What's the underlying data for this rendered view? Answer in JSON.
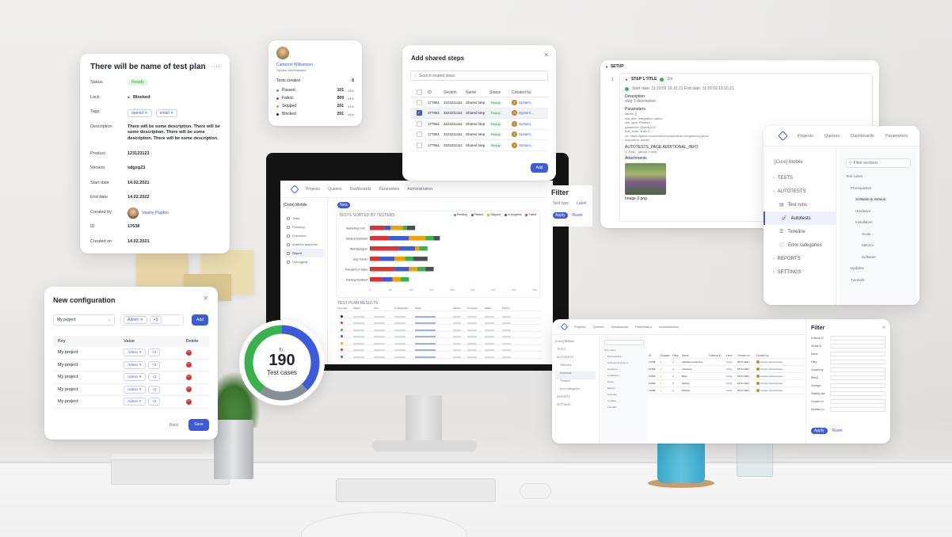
{
  "test_plan": {
    "title": "There will be name of test plan",
    "menu_icon": "more-icon",
    "fields": [
      {
        "label": "Status",
        "value": "Ready"
      },
      {
        "label": "Lock",
        "value": "Blocked"
      },
      {
        "label": "Tags",
        "value": ""
      },
      {
        "label": "Description",
        "value": "There will be some description. There will be some description. There will be some description. There will be some description."
      },
      {
        "label": "Product",
        "value": "123123123"
      },
      {
        "label": "Version",
        "value": "sdgsg23"
      },
      {
        "label": "Start date",
        "value": "14.02.2021"
      },
      {
        "label": "End date",
        "value": "14.02.2022"
      },
      {
        "label": "Created by",
        "value": "Vasiliy Pupkin"
      },
      {
        "label": "ID",
        "value": "17638"
      },
      {
        "label": "Created on",
        "value": "14.02.2021"
      }
    ],
    "tags": [
      "openid",
      "email"
    ]
  },
  "user_stats": {
    "name": "Cameron Williamson",
    "role": "System Administrator",
    "tests_created_label": "Tests created",
    "tests_created_value": "6",
    "rows": [
      {
        "label": "Passed",
        "count": "101",
        "pct": "44%",
        "color": "#37b24d"
      },
      {
        "label": "Failed",
        "count": "909",
        "pct": "34%",
        "color": "#e03131"
      },
      {
        "label": "Skipped",
        "count": "201",
        "pct": "44%",
        "color": "#f59f00"
      },
      {
        "label": "Blocked",
        "count": "201",
        "pct": "44%",
        "color": "#1f2430"
      }
    ]
  },
  "shared_steps": {
    "title": "Add shared steps",
    "search_placeholder": "Search shared steps",
    "columns": [
      "ID",
      "Section",
      "Name",
      "Status",
      "Created by"
    ],
    "rows": [
      {
        "id": "177861",
        "section": "3222211111",
        "name": "Shared step",
        "status": "Ready",
        "created_by": "System...",
        "checked": false
      },
      {
        "id": "177861",
        "section": "3222211111",
        "name": "Shared step",
        "status": "Ready",
        "created_by": "System...",
        "checked": true
      },
      {
        "id": "177861",
        "section": "3222211111",
        "name": "Shared step",
        "status": "Ready",
        "created_by": "System...",
        "checked": false
      },
      {
        "id": "177861",
        "section": "3222211111",
        "name": "Shared step",
        "status": "Ready",
        "created_by": "System...",
        "checked": false
      },
      {
        "id": "177861",
        "section": "3222211111",
        "name": "Shared step",
        "status": "Ready",
        "created_by": "System...",
        "checked": false
      }
    ],
    "add_label": "Add"
  },
  "setup": {
    "header": "SETUP",
    "line_no": "1",
    "step_title": "STEP 1 TITLE",
    "step_duration": "2m",
    "dates": "Start date: 11:20:59 19.10.21   End date: 11:20:59 19.10.21",
    "description_label": "Description",
    "description_value": "step 1 description",
    "parameters_label": "Parameters",
    "params": [
      "labels: []",
      "link_title: Integration option",
      "link_type: Related",
      "password: Qwerty123",
      "test_suite: suite 2",
      "url: https://github.com/testit-tms/autotests-integration-python",
      "username: admin"
    ],
    "autotests_label": "AUTOTESTS_PAGE.ADDITIONAL_INFO",
    "autotests_value": "1: /tmp... (about 1 test)",
    "attachments_label": "Attachments",
    "attachment_name": "Image 2.png"
  },
  "nav_card": {
    "top_tabs": [
      "Projects",
      "Queries",
      "Dashboards",
      "Parameters"
    ],
    "project": "[Core] Mobile",
    "filter_placeholder": "Filter sections",
    "left_items": [
      {
        "label": "TESTS",
        "type": "group"
      },
      {
        "label": "AUTOTESTS",
        "type": "group"
      },
      {
        "label": "Test runs",
        "type": "item",
        "icon": "runs-icon"
      },
      {
        "label": "Autotests",
        "type": "item",
        "icon": "rocket-icon",
        "active": true
      },
      {
        "label": "Timeline",
        "type": "item",
        "icon": "timeline-icon"
      },
      {
        "label": "Error categories",
        "type": "item",
        "icon": "error-icon"
      },
      {
        "label": "REPORTS",
        "type": "group"
      },
      {
        "label": "SETTINGS",
        "type": "group"
      }
    ],
    "tree": [
      "Test suites",
      "Prerequisites",
      "Software & Version",
      "Hardware",
      "Installation",
      "Scale",
      "Metrics",
      "Software",
      "Updates",
      "Tutorials"
    ]
  },
  "new_configuration": {
    "title": "New configuration",
    "project_select": "My project",
    "chips_value": "Admin",
    "chips_more": "+3",
    "add_label": "Add",
    "columns": [
      "Key",
      "Value",
      "Delete"
    ],
    "rows": [
      {
        "key": "My project",
        "value": "Admin",
        "more": "+3"
      },
      {
        "key": "My project",
        "value": "Admin",
        "more": "+3"
      },
      {
        "key": "My project",
        "value": "Admin",
        "more": "+3"
      },
      {
        "key": "My project",
        "value": "Admin",
        "more": "+3"
      },
      {
        "key": "My project",
        "value": "Admin",
        "more": "+3"
      }
    ],
    "back_label": "Back",
    "save_label": "Save"
  },
  "donut": {
    "value": "190",
    "label": "Test cases",
    "segments": [
      {
        "name": "blue",
        "value": 0.38,
        "color": "#3b5bdb"
      },
      {
        "name": "gray",
        "value": 0.22,
        "color": "#868e96"
      },
      {
        "name": "green",
        "value": 0.4,
        "color": "#37b24d"
      }
    ]
  },
  "monitor_app": {
    "nav": [
      "Projects",
      "Queries",
      "Dashboards",
      "Parameters",
      "Administration"
    ],
    "project": "[Core] Mobile",
    "side_items": [
      "Tests",
      "Planning",
      "Execution",
      "Autotest launches",
      "Report",
      "Debugging"
    ],
    "chart_title": "TESTS SORTED BY TESTERS",
    "legend": [
      {
        "label": "Pending",
        "color": "#37b24d"
      },
      {
        "label": "Passed",
        "color": "#3b5bdb"
      },
      {
        "label": "Skipped",
        "color": "#f59f00"
      },
      {
        "label": "In progress",
        "color": "#495057"
      },
      {
        "label": "Failed",
        "color": "#e03131"
      }
    ],
    "rows_label": "TEST PLAN RESULTS",
    "filter_title": "Filter",
    "filter_fields": [
      "Test type",
      "Label"
    ],
    "apply_label": "Apply",
    "reset_label": "Reset",
    "new_label": "New",
    "table_headers": [
      "Line type",
      "Status",
      "Test",
      "Configuration",
      "Tester",
      "Version",
      "Comment",
      "Status",
      "Priority"
    ]
  },
  "chart_data": {
    "type": "bar",
    "orientation": "horizontal-stacked",
    "categories": [
      "Marketing Com...",
      "Medical Assistant",
      "Web Designer",
      "Dog Trainer",
      "President of Sales",
      "Nursing Assistant"
    ],
    "series": [
      {
        "name": "Failed",
        "color": "#e03131",
        "values": [
          35,
          45,
          70,
          25,
          60,
          30
        ]
      },
      {
        "name": "Passed",
        "color": "#3b5bdb",
        "values": [
          15,
          50,
          40,
          35,
          35,
          25
        ]
      },
      {
        "name": "Skipped",
        "color": "#f59f00",
        "values": [
          30,
          40,
          10,
          25,
          20,
          20
        ]
      },
      {
        "name": "Pending",
        "color": "#37b24d",
        "values": [
          10,
          20,
          20,
          20,
          20,
          20
        ]
      },
      {
        "name": "In progress",
        "color": "#495057",
        "values": [
          20,
          15,
          0,
          35,
          20,
          0
        ]
      }
    ],
    "xlim": [
      0,
      400
    ],
    "xticks": [
      "0",
      "50",
      "100",
      "150",
      "200",
      "250",
      "300",
      "350",
      "400"
    ]
  },
  "autotests_card": {
    "nav": [
      "Projects",
      "Queries",
      "Dashboards",
      "Parameters",
      "Administration"
    ],
    "project": "[Core] Mobile",
    "filter_title": "Filter",
    "filter_labels": [
      "External ID",
      "Global ID",
      "Name",
      "Flaky",
      "Created by",
      "Result",
      "Changes",
      "Stability rate",
      "Created on",
      "Modified on"
    ],
    "apply_label": "Apply",
    "reset_label": "Reset",
    "headers": [
      "ID",
      "Changes",
      "Flaky",
      "Name",
      "External ID",
      "Links",
      "Created on",
      "Created by"
    ],
    "rows": [
      {
        "id": "17638",
        "name": "Indicates a warning",
        "links": "string",
        "date": "26.07.2021",
        "by": "System Administrator"
      },
      {
        "id": "17638",
        "name": "Autotests",
        "links": "string",
        "date": "26.07.2021",
        "by": "System Administrator"
      },
      {
        "id": "17638",
        "name": "Body",
        "links": "string",
        "date": "26.07.2021",
        "by": "System Administrator"
      },
      {
        "id": "17638",
        "name": "Setting",
        "links": "string",
        "date": "26.07.2021",
        "by": "System Administrator"
      },
      {
        "id": "17638",
        "name": "Method",
        "links": "string",
        "date": "26.07.2021",
        "by": "System Administrator"
      }
    ]
  }
}
